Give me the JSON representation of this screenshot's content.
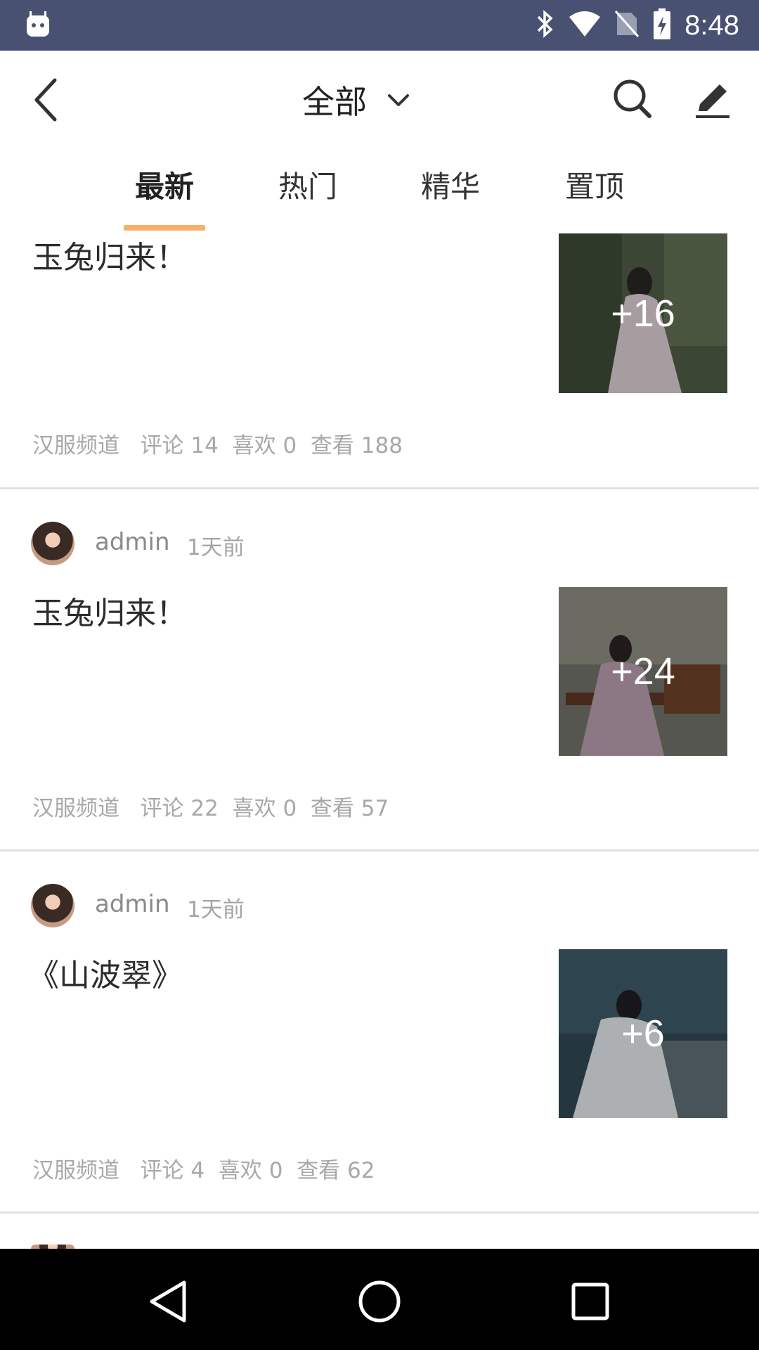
{
  "status_bar": {
    "time": "8:48",
    "icons": [
      "android-icon",
      "bluetooth-icon",
      "wifi-icon",
      "no-sim-icon",
      "battery-charging-icon"
    ]
  },
  "header": {
    "title": "全部",
    "icons": [
      "back-icon",
      "chevron-down-icon",
      "search-icon",
      "edit-icon"
    ]
  },
  "tabs": [
    {
      "label": "最新",
      "active": true
    },
    {
      "label": "热门",
      "active": false
    },
    {
      "label": "精华",
      "active": false
    },
    {
      "label": "置顶",
      "active": false
    }
  ],
  "posts": [
    {
      "title": "玉兔归来！",
      "image_count": "+16",
      "channel": "汉服频道",
      "comments_label": "评论",
      "comments": "14",
      "likes_label": "喜欢",
      "likes": "0",
      "views_label": "查看",
      "views": "188"
    },
    {
      "author": "admin",
      "time": "1天前",
      "title": "玉兔归来！",
      "image_count": "+24",
      "channel": "汉服频道",
      "comments_label": "评论",
      "comments": "22",
      "likes_label": "喜欢",
      "likes": "0",
      "views_label": "查看",
      "views": "57"
    },
    {
      "author": "admin",
      "time": "1天前",
      "title": "《山波翠》",
      "image_count": "+6",
      "channel": "汉服频道",
      "comments_label": "评论",
      "comments": "4",
      "likes_label": "喜欢",
      "likes": "0",
      "views_label": "查看",
      "views": "62"
    }
  ],
  "nav_bar": {
    "icons": [
      "back-triangle-icon",
      "home-circle-icon",
      "recents-square-icon"
    ]
  }
}
